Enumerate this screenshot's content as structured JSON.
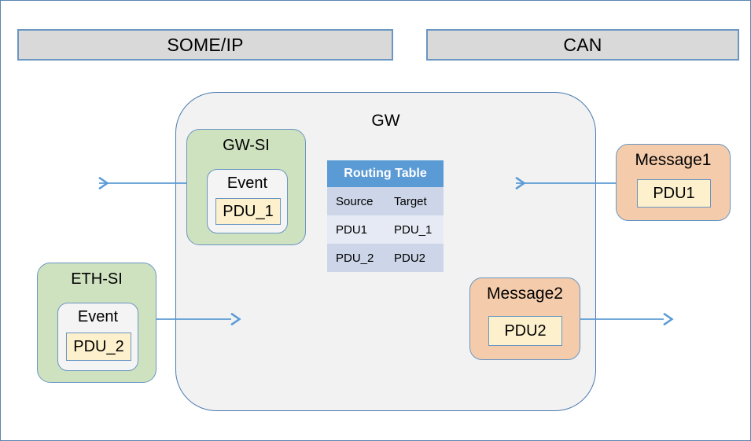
{
  "diagram": {
    "title_left": "SOME/IP",
    "title_right": "CAN",
    "gw_label": "GW"
  },
  "protocols": {
    "someip": "SOME/IP",
    "can": "CAN"
  },
  "gateway": {
    "label": "GW"
  },
  "service_interfaces": [
    {
      "name": "GW-SI",
      "event_label": "Event",
      "pdu_label": "PDU_1"
    },
    {
      "name": "ETH-SI",
      "event_label": "Event",
      "pdu_label": "PDU_2"
    }
  ],
  "messages": [
    {
      "name": "Message1",
      "pdu_label": "PDU1"
    },
    {
      "name": "Message2",
      "pdu_label": "PDU2"
    }
  ],
  "routing_table": {
    "title": "Routing Table",
    "columns": [
      "Source",
      "Target"
    ],
    "rows": [
      {
        "source": "PDU1",
        "target": "PDU_1"
      },
      {
        "source": "PDU_2",
        "target": "PDU2"
      }
    ]
  },
  "arrows": [
    {
      "name": "gw-si-out-left",
      "direction": "left"
    },
    {
      "name": "message1-in-left",
      "direction": "left"
    },
    {
      "name": "eth-si-in-right",
      "direction": "right"
    },
    {
      "name": "message2-out-right",
      "direction": "right"
    }
  ],
  "colors": {
    "frame_border": "#5a85b0",
    "protocol_bar_fill": "#d9d9d9",
    "protocol_bar_border": "#6a96c2",
    "gateway_fill": "#f2f2f2",
    "gateway_border": "#4a7ab0",
    "service_interface_fill": "#cfe2c0",
    "event_fill": "#f4f4f4",
    "pdu_fill": "#fdf0cd",
    "message_fill": "#f5ccab",
    "table_header_fill": "#5b9bd5",
    "table_row_dark": "#ccd6e8",
    "table_row_light": "#e5eaf4",
    "arrow_stroke": "#5b9bd5"
  }
}
